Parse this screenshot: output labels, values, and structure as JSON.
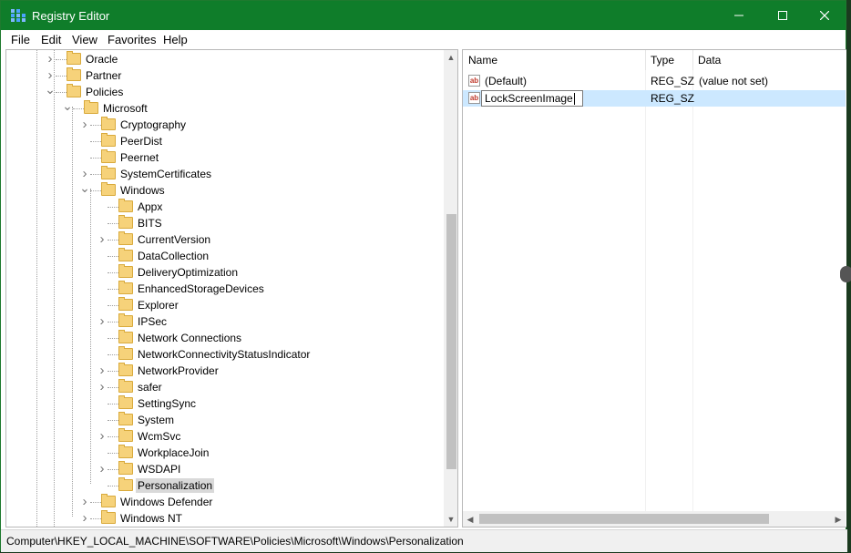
{
  "window": {
    "title": "Registry Editor",
    "controls": {
      "minimize": "—",
      "maximize": "☐",
      "close": "✕"
    }
  },
  "menu": [
    "File",
    "Edit",
    "View",
    "Favorites",
    "Help"
  ],
  "tree": [
    {
      "label": "Oracle",
      "expander": ">"
    },
    {
      "label": "Partner",
      "expander": ">"
    },
    {
      "label": "Policies",
      "expander": "v"
    },
    {
      "label": "Microsoft",
      "expander": "v"
    },
    {
      "label": "Cryptography",
      "expander": ">"
    },
    {
      "label": "PeerDist",
      "expander": ""
    },
    {
      "label": "Peernet",
      "expander": ""
    },
    {
      "label": "SystemCertificates",
      "expander": ">"
    },
    {
      "label": "Windows",
      "expander": "v"
    },
    {
      "label": "Appx",
      "expander": ""
    },
    {
      "label": "BITS",
      "expander": ""
    },
    {
      "label": "CurrentVersion",
      "expander": ">"
    },
    {
      "label": "DataCollection",
      "expander": ""
    },
    {
      "label": "DeliveryOptimization",
      "expander": ""
    },
    {
      "label": "EnhancedStorageDevices",
      "expander": ""
    },
    {
      "label": "Explorer",
      "expander": ""
    },
    {
      "label": "IPSec",
      "expander": ">"
    },
    {
      "label": "Network Connections",
      "expander": ""
    },
    {
      "label": "NetworkConnectivityStatusIndicator",
      "expander": ""
    },
    {
      "label": "NetworkProvider",
      "expander": ">"
    },
    {
      "label": "safer",
      "expander": ">"
    },
    {
      "label": "SettingSync",
      "expander": ""
    },
    {
      "label": "System",
      "expander": ""
    },
    {
      "label": "WcmSvc",
      "expander": ">"
    },
    {
      "label": "WorkplaceJoin",
      "expander": ""
    },
    {
      "label": "WSDAPI",
      "expander": ">"
    },
    {
      "label": "Personalization",
      "expander": "",
      "selected": true
    },
    {
      "label": "Windows Defender",
      "expander": ">"
    },
    {
      "label": "Windows NT",
      "expander": ">"
    }
  ],
  "list": {
    "columns": [
      "Name",
      "Type",
      "Data"
    ],
    "rows": [
      {
        "icon": "ab",
        "name": "(Default)",
        "type": "REG_SZ",
        "data": "(value not set)"
      },
      {
        "icon": "ab",
        "name": "LockScreenImage",
        "type": "REG_SZ",
        "data": "",
        "editing": true
      }
    ]
  },
  "status": {
    "path": "Computer\\HKEY_LOCAL_MACHINE\\SOFTWARE\\Policies\\Microsoft\\Windows\\Personalization"
  },
  "colors": {
    "titlebar": "#0f7d2a",
    "selection": "#cce8ff",
    "folder": "#f6d27a"
  }
}
